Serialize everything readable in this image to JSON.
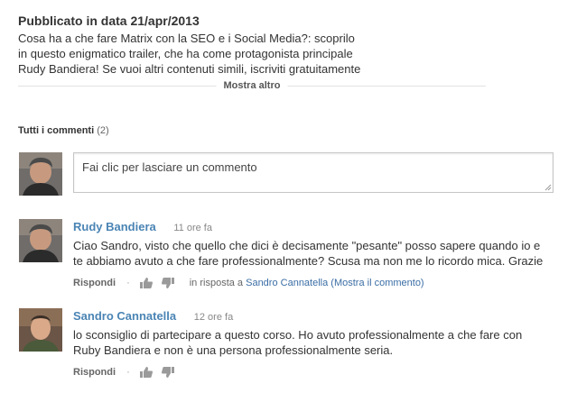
{
  "description": {
    "title": "Pubblicato in data 21/apr/2013",
    "lines": [
      "Cosa ha a che fare Matrix con la SEO e i Social Media?: scoprilo",
      "in questo enigmatico trailer, che ha come protagonista principale",
      "Rudy Bandiera! Se vuoi altri contenuti simili, iscriviti gratuitamente"
    ],
    "show_more": "Mostra altro"
  },
  "comments_header": {
    "label": "Tutti i commenti",
    "count": "(2)"
  },
  "comment_box": {
    "placeholder": "Fai clic per lasciare un commento"
  },
  "comments": [
    {
      "author": "Rudy Bandiera",
      "time": "11 ore fa",
      "lines": [
        "Ciao Sandro, visto che quello che dici è decisamente \"pesante\" posso sapere quando io e",
        "te abbiamo avuto a che fare professionalmente? Scusa ma non me lo ricordo mica. Grazie"
      ],
      "reply_label": "Rispondi",
      "separator": "·",
      "reply_prefix": "in risposta a",
      "reply_to": "Sandro Cannatella",
      "show_comment": "(Mostra il commento)"
    },
    {
      "author": "Sandro Cannatella",
      "time": "12 ore fa",
      "lines": [
        "lo sconsiglio di partecipare a questo corso. Ho avuto professionalmente a che fare con",
        "Ruby Bandiera e non è una persona professionalmente seria."
      ],
      "reply_label": "Rispondi",
      "separator": "·"
    }
  ],
  "colors": {
    "author_link": "#4a84b4",
    "text": "#333333",
    "muted": "#888888",
    "border": "#c6c6c6"
  },
  "icons": [
    "thumbs-up-icon",
    "thumbs-down-icon",
    "resize-grip-icon"
  ]
}
